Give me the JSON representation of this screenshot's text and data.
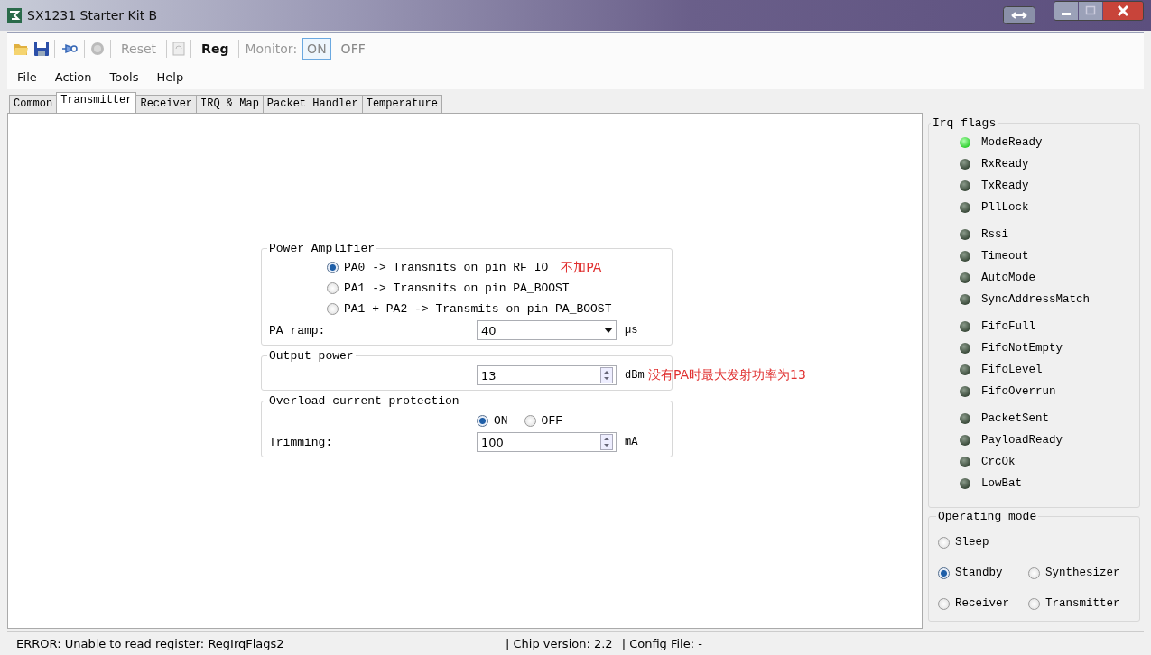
{
  "window": {
    "title": "SX1231 Starter Kit B"
  },
  "toolbar": {
    "buttons": [
      {
        "label": "Reset",
        "disabled": true
      },
      {
        "label": "Reg",
        "disabled": false
      }
    ],
    "monitor": {
      "label": "Monitor:",
      "options": [
        {
          "label": "ON",
          "selected": true
        },
        {
          "label": "OFF",
          "selected": false
        }
      ]
    }
  },
  "menu": [
    "File",
    "Action",
    "Tools",
    "Help"
  ],
  "tabs": [
    {
      "label": "Common",
      "selected": false
    },
    {
      "label": "Transmitter",
      "selected": true
    },
    {
      "label": "Receiver",
      "selected": false
    },
    {
      "label": "IRQ & Map",
      "selected": false
    },
    {
      "label": "Packet Handler",
      "selected": false
    },
    {
      "label": "Temperature",
      "selected": false
    }
  ],
  "power_amplifier": {
    "title": "Power Amplifier",
    "options": [
      {
        "label": "PA0 -> Transmits on pin RF_IO",
        "selected": true,
        "note": "不加PA"
      },
      {
        "label": "PA1 -> Transmits on pin PA_BOOST",
        "selected": false
      },
      {
        "label": "PA1 + PA2 -> Transmits on pin PA_BOOST",
        "selected": false
      }
    ],
    "ramp": {
      "label": "PA ramp:",
      "value": "40",
      "unit": "µs"
    }
  },
  "output_power": {
    "title": "Output power",
    "value": "13",
    "unit": "dBm",
    "note": "没有PA时最大发射功率为13"
  },
  "overload": {
    "title": "Overload current protection",
    "options": [
      {
        "label": "ON",
        "selected": true
      },
      {
        "label": "OFF",
        "selected": false
      }
    ],
    "trimming": {
      "label": "Trimming:",
      "value": "100",
      "unit": "mA"
    }
  },
  "irq_flags": {
    "title": "Irq flags",
    "groups": [
      {
        "flags": [
          {
            "label": "ModeReady",
            "on": true
          },
          {
            "label": "RxReady",
            "on": false
          },
          {
            "label": "TxReady",
            "on": false
          },
          {
            "label": "PllLock",
            "on": false
          }
        ]
      },
      {
        "flags": [
          {
            "label": "Rssi",
            "on": false
          },
          {
            "label": "Timeout",
            "on": false
          },
          {
            "label": "AutoMode",
            "on": false
          },
          {
            "label": "SyncAddressMatch",
            "on": false
          }
        ]
      },
      {
        "flags": [
          {
            "label": "FifoFull",
            "on": false
          },
          {
            "label": "FifoNotEmpty",
            "on": false
          },
          {
            "label": "FifoLevel",
            "on": false
          },
          {
            "label": "FifoOverrun",
            "on": false
          }
        ]
      },
      {
        "flags": [
          {
            "label": "PacketSent",
            "on": false
          },
          {
            "label": "PayloadReady",
            "on": false
          },
          {
            "label": "CrcOk",
            "on": false
          },
          {
            "label": "LowBat",
            "on": false
          }
        ]
      }
    ]
  },
  "operating_mode": {
    "title": "Operating mode",
    "rows": [
      [
        {
          "label": "Sleep",
          "selected": false
        }
      ],
      [
        {
          "label": "Standby",
          "selected": true
        },
        {
          "label": "Synthesizer",
          "selected": false
        }
      ],
      [
        {
          "label": "Receiver",
          "selected": false
        },
        {
          "label": "Transmitter",
          "selected": false
        }
      ]
    ]
  },
  "status_bar": [
    "ERROR: Unable to read register: RegIrqFlags2",
    "| Chip version: 2.2",
    "| Config File: -"
  ]
}
